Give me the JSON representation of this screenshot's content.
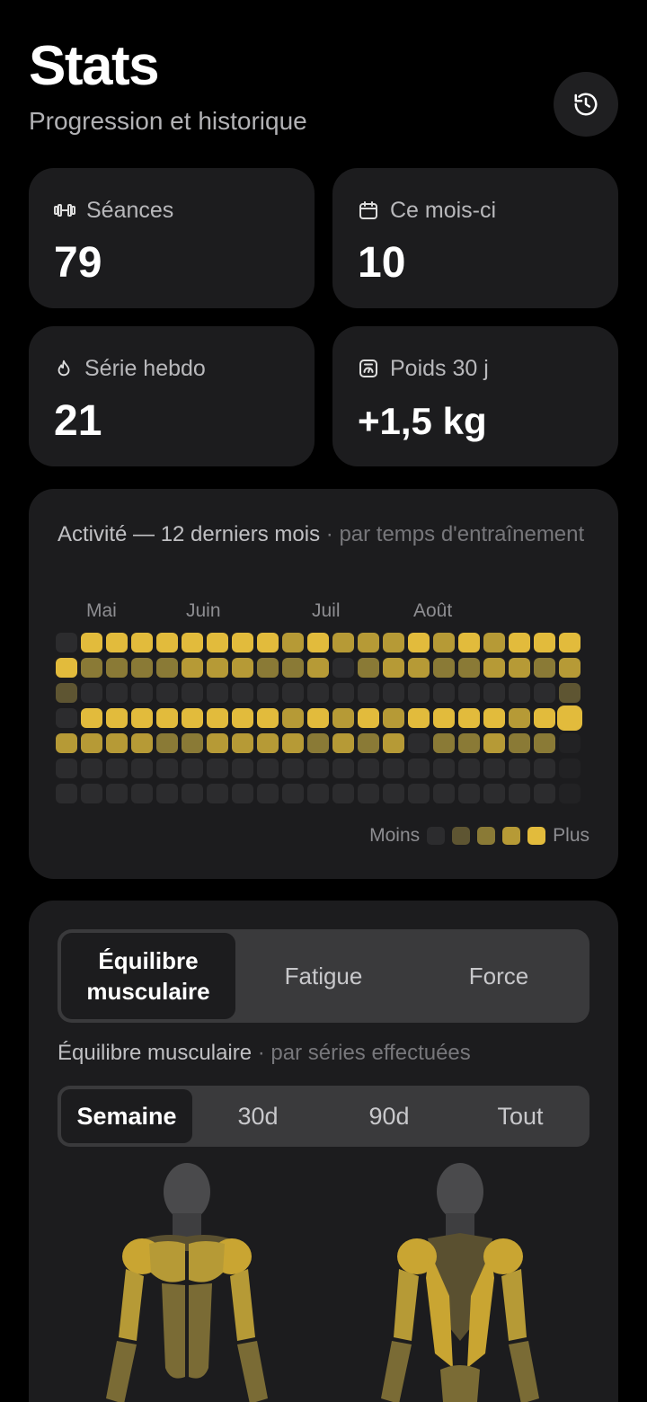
{
  "header": {
    "title": "Stats",
    "subtitle": "Progression et historique",
    "history_icon": "history-icon"
  },
  "stats": [
    {
      "icon": "dumbbell-icon",
      "label": "Séances",
      "value": "79"
    },
    {
      "icon": "calendar-icon",
      "label": "Ce mois-ci",
      "value": "10"
    },
    {
      "icon": "flame-icon",
      "label": "Série hebdo",
      "value": "21"
    },
    {
      "icon": "scale-icon",
      "label": "Poids 30 j",
      "value": "+1,5 kg"
    }
  ],
  "activity": {
    "title": "Activité — 12 derniers mois",
    "subtitle": " · par temps d'entraînement",
    "months": [
      "Mai",
      "Juin",
      "Juil",
      "Août"
    ],
    "legend_less": "Moins",
    "legend_more": "Plus",
    "levels_colors": [
      "#2c2c2e",
      "#5e5532",
      "#8a7a36",
      "#b69a36",
      "#e2bb3c"
    ],
    "weeks": [
      [
        0,
        4,
        1,
        0,
        3,
        0,
        0
      ],
      [
        4,
        2,
        0,
        4,
        3,
        0,
        0
      ],
      [
        4,
        2,
        0,
        4,
        3,
        0,
        0
      ],
      [
        4,
        2,
        0,
        4,
        3,
        0,
        0
      ],
      [
        4,
        2,
        0,
        4,
        2,
        0,
        0
      ],
      [
        4,
        3,
        0,
        4,
        2,
        0,
        0
      ],
      [
        4,
        3,
        0,
        4,
        3,
        0,
        0
      ],
      [
        4,
        3,
        0,
        4,
        3,
        0,
        0
      ],
      [
        4,
        2,
        0,
        4,
        3,
        0,
        0
      ],
      [
        3,
        2,
        0,
        3,
        3,
        0,
        0
      ],
      [
        4,
        3,
        0,
        4,
        2,
        0,
        0
      ],
      [
        3,
        0,
        0,
        3,
        3,
        0,
        0
      ],
      [
        3,
        2,
        0,
        4,
        2,
        0,
        0
      ],
      [
        3,
        3,
        0,
        3,
        3,
        0,
        0
      ],
      [
        4,
        3,
        0,
        4,
        0,
        0,
        0
      ],
      [
        3,
        2,
        0,
        4,
        2,
        0,
        0
      ],
      [
        4,
        2,
        0,
        4,
        2,
        0,
        0
      ],
      [
        3,
        3,
        0,
        4,
        3,
        0,
        0
      ],
      [
        4,
        3,
        0,
        3,
        2,
        0,
        0
      ],
      [
        4,
        2,
        0,
        4,
        2,
        0,
        0
      ],
      [
        4,
        3,
        1,
        4,
        1,
        1,
        1
      ]
    ]
  },
  "muscles": {
    "tabs": [
      "Équilibre musculaire",
      "Fatigue",
      "Force"
    ],
    "active_tab": 0,
    "section_title": "Équilibre musculaire",
    "section_subtitle": " · par séries effectuées",
    "periods": [
      "Semaine",
      "30d",
      "90d",
      "Tout"
    ],
    "active_period": 0,
    "colors": {
      "head": "#4a4a4c",
      "strong": "#c9a532",
      "mid": "#b69a36",
      "low": "#7a6b35",
      "dark": "#5a5030"
    }
  }
}
